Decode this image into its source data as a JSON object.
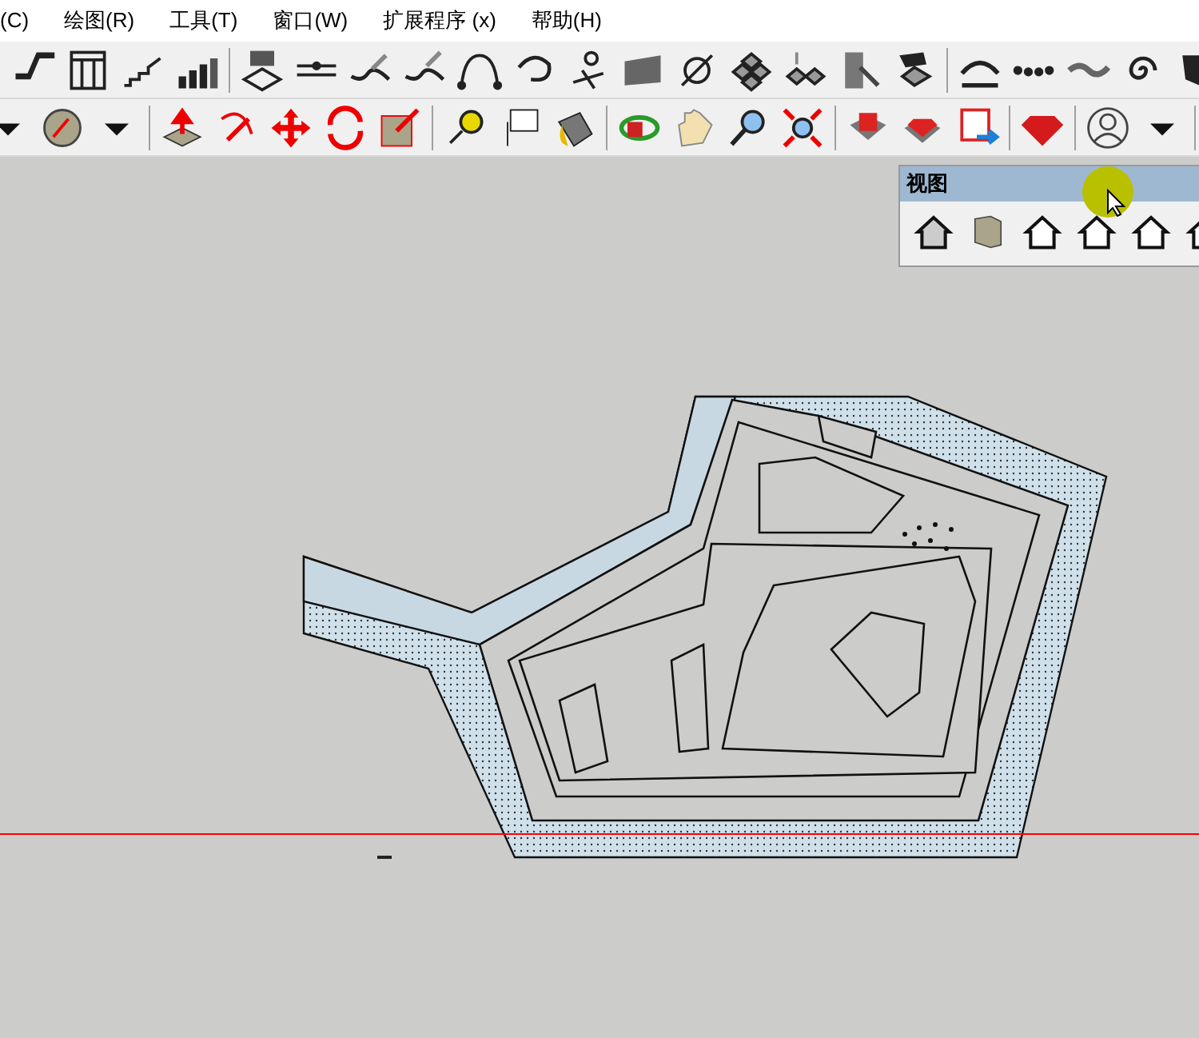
{
  "menu": [
    {
      "label": "(C)"
    },
    {
      "label": "绘图(R)"
    },
    {
      "label": "工具(T)"
    },
    {
      "label": "窗口(W)"
    },
    {
      "label": "扩展程序 (x)"
    },
    {
      "label": "帮助(H)"
    }
  ],
  "view_panel": {
    "title": "视图"
  }
}
